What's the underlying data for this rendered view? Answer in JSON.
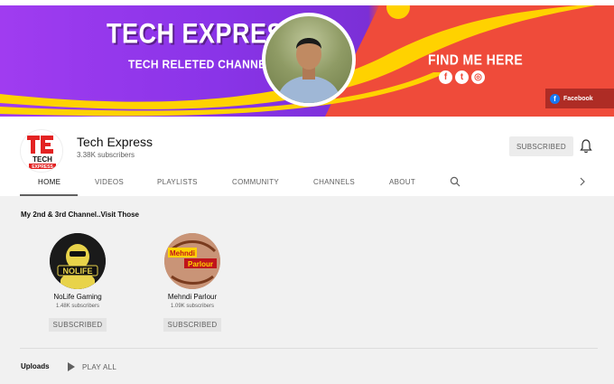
{
  "banner": {
    "title": "TECH EXPRESS",
    "subtitle": "TECH RELETED CHANNEL",
    "find_me": "FIND ME HERE",
    "social_icons": [
      "facebook-icon",
      "twitter-icon",
      "instagram-icon"
    ],
    "link_label": "Facebook",
    "colors": {
      "purple": "#8a34e8",
      "red": "#ef4b3a",
      "yellow": "#ffd200"
    }
  },
  "channel": {
    "name": "Tech Express",
    "subscribers": "3.38K subscribers",
    "subscribe_label": "SUBSCRIBED",
    "logo_text": "TECH",
    "logo_sub": "EXPRESS"
  },
  "tabs": [
    {
      "label": "HOME"
    },
    {
      "label": "VIDEOS"
    },
    {
      "label": "PLAYLISTS"
    },
    {
      "label": "COMMUNITY"
    },
    {
      "label": "CHANNELS"
    },
    {
      "label": "ABOUT"
    }
  ],
  "featured": {
    "title": "My 2nd & 3rd Channel..Visit Those",
    "channels": [
      {
        "name": "NoLife Gaming",
        "subs": "1.48K subscribers",
        "button": "SUBSCRIBED",
        "badge": "NOLIFE"
      },
      {
        "name": "Mehndi Parlour",
        "subs": "1.09K subscribers",
        "button": "SUBSCRIBED",
        "badge1": "Mehndi",
        "badge2": "Parlour"
      }
    ]
  },
  "uploads": {
    "title": "Uploads",
    "play_all": "PLAY ALL"
  }
}
